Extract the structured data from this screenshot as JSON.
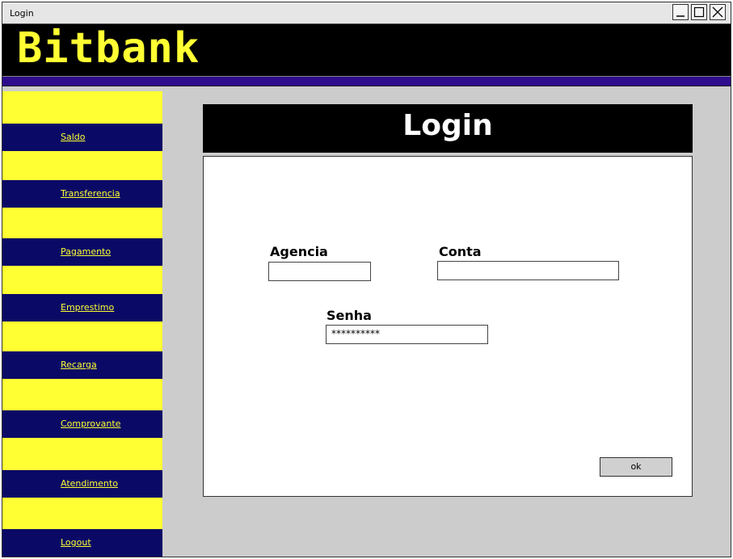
{
  "window": {
    "title": "Login",
    "controls": [
      "minimize",
      "maximize",
      "close"
    ]
  },
  "app": {
    "brand": "Bitbank"
  },
  "sidebar": {
    "items": [
      {
        "label": "Saldo"
      },
      {
        "label": "Transferencia"
      },
      {
        "label": "Pagamento"
      },
      {
        "label": "Emprestimo"
      },
      {
        "label": "Recarga"
      },
      {
        "label": "Comprovante"
      },
      {
        "label": "Atendimento"
      },
      {
        "label": "Logout"
      }
    ]
  },
  "main": {
    "header": "Login",
    "form": {
      "agencia_label": "Agencia",
      "agencia_value": "",
      "conta_label": "Conta",
      "conta_value": "",
      "senha_label": "Senha",
      "senha_value": "**********",
      "ok_label": "ok"
    }
  },
  "colors": {
    "brand_yellow": "#ffff33",
    "nav_blue": "#0a0a66",
    "stripe_purple": "#2e0d8c",
    "background_gray": "#cccccc"
  }
}
